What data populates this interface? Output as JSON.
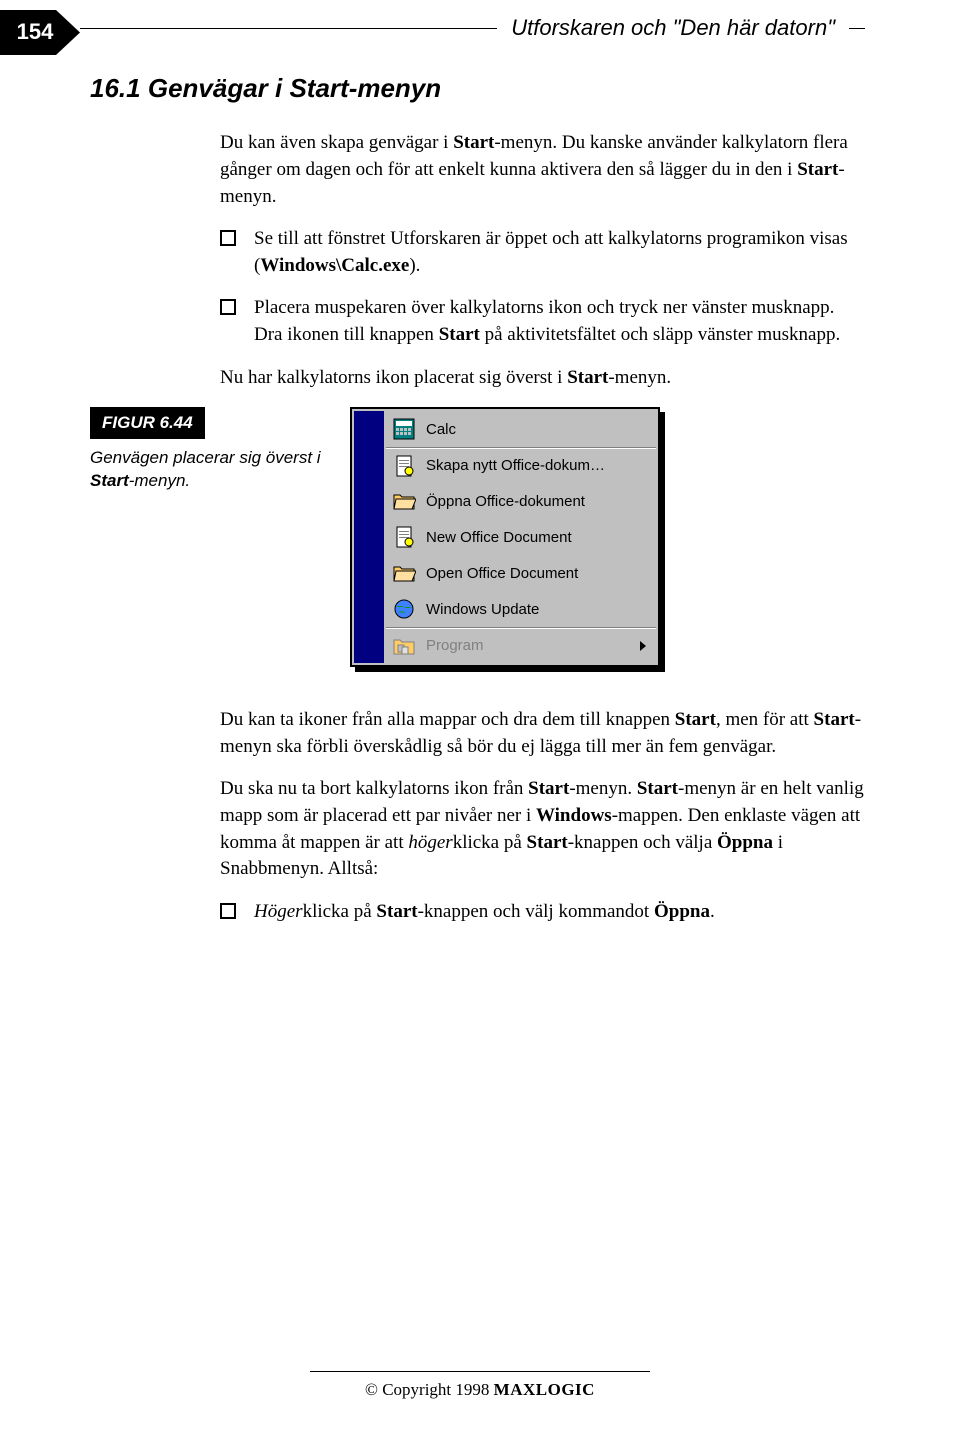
{
  "page_number": "154",
  "running_header": "Utforskaren och \"Den här datorn\"",
  "section_number": "16.1",
  "section_title": "Genvägar i Start-menyn",
  "p1_a": "Du kan även skapa genvägar i ",
  "p1_b": "Start",
  "p1_c": "-menyn. Du kanske använder kalkylatorn flera gånger om dagen och för att enkelt kunna aktivera den så lägger du in den i ",
  "p1_d": "Start",
  "p1_e": "-menyn.",
  "check1_a": "Se till att fönstret Utforskaren är öppet och att kalkylatorns programikon visas (",
  "check1_b": "Windows\\Calc.exe",
  "check1_c": ").",
  "check2_a": "Placera muspekaren över kalkylatorns ikon och tryck ner vänster musknapp. Dra ikonen till knappen ",
  "check2_b": "Start",
  "check2_c": " på aktivitetsfältet och släpp vänster musknapp.",
  "p2_a": "Nu har kalkylatorns ikon placerat sig överst i ",
  "p2_b": "Start",
  "p2_c": "-menyn.",
  "figure_label": "FIGUR 6.44",
  "figure_caption_a": "Genvägen placerar sig överst i ",
  "figure_caption_b": "Start",
  "figure_caption_c": "-menyn.",
  "menu": {
    "items": [
      {
        "label": "Calc",
        "icon": "calc"
      },
      {
        "label": "Skapa nytt Office-dokum…",
        "icon": "newdoc"
      },
      {
        "label": "Öppna Office-dokument",
        "icon": "folder"
      },
      {
        "label": "New Office Document",
        "icon": "newdoc"
      },
      {
        "label": "Open Office Document",
        "icon": "folder"
      },
      {
        "label": "Windows Update",
        "icon": "globe"
      },
      {
        "label": "Program",
        "icon": "folder-open",
        "has_arrow": true,
        "disabled": true
      }
    ]
  },
  "p3_a": "Du kan ta ikoner från alla mappar och dra dem till knappen ",
  "p3_b": "Start",
  "p3_c": ", men för att ",
  "p3_d": "Start",
  "p3_e": "-menyn ska förbli överskådlig så bör du ej lägga till mer än fem genvägar.",
  "p4_a": "Du ska nu ta bort kalkylatorns ikon från ",
  "p4_b": "Start",
  "p4_c": "-menyn. ",
  "p4_d": "Start",
  "p4_e": "-menyn är en helt vanlig mapp som är placerad ett par nivåer ner i ",
  "p4_f": "Windows",
  "p4_g": "-mappen. Den enklaste vägen att komma åt mappen är att ",
  "p4_h": "höger",
  "p4_i": "klicka på ",
  "p4_j": "Start",
  "p4_k": "-knappen och välja ",
  "p4_l": "Öppna",
  "p4_m": " i Snabbmenyn. Alltså:",
  "check3_a": "Höger",
  "check3_b": "klicka på ",
  "check3_c": "Start",
  "check3_d": "-knappen och välj kommandot ",
  "check3_e": "Öppna",
  "check3_f": ".",
  "footer_copyright": "© Copyright 1998",
  "footer_brand": "MAXLOGIC"
}
